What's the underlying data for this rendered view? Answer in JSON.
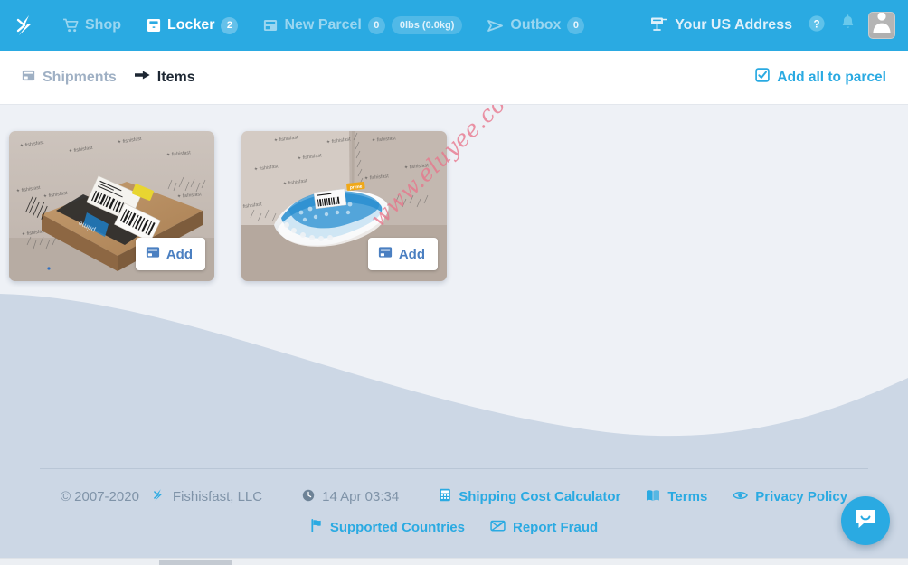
{
  "colors": {
    "brand_blue": "#2aaae2",
    "nav_inactive": "#9ad6f0",
    "wave_dark": "#ccd7e5",
    "wave_light": "#eaeef4",
    "page_bg": "#eef1f6",
    "watermark": "#e8768c",
    "add_text": "#4a7fc1"
  },
  "header": {
    "brand_icon": "fishisfast-logo-icon",
    "nav": [
      {
        "label": "Shop",
        "icon": "shopping-cart-icon",
        "active": false,
        "badge": null,
        "pill": null
      },
      {
        "label": "Locker",
        "icon": "locker-box-icon",
        "active": true,
        "badge": "2",
        "pill": null
      },
      {
        "label": "New Parcel",
        "icon": "parcel-box-icon",
        "active": false,
        "badge": "0",
        "pill": "0lbs (0.0kg)"
      },
      {
        "label": "Outbox",
        "icon": "paper-plane-icon",
        "active": false,
        "badge": "0",
        "pill": null
      }
    ],
    "address_label": "Your US Address",
    "address_icon": "mailbox-icon",
    "help_icon": "question-circle-icon",
    "bell_icon": "notification-bell-icon",
    "avatar_icon": "user-avatar-icon"
  },
  "subnav": {
    "tabs": [
      {
        "label": "Shipments",
        "icon": "shipments-box-icon",
        "active": false
      },
      {
        "label": "Items",
        "icon": "arrow-right-icon",
        "active": true
      }
    ],
    "action": {
      "label": "Add all to parcel",
      "icon": "checkbox-checked-icon"
    }
  },
  "items": [
    {
      "photo_alt": "cardboard-amazon-prime-box-on-shelf",
      "add_label": "Add",
      "add_icon": "parcel-box-icon"
    },
    {
      "photo_alt": "blue-white-bubble-mailer-envelope",
      "add_label": "Add",
      "add_icon": "parcel-box-icon"
    }
  ],
  "watermark": {
    "text": "www.eluyee.com"
  },
  "footer": {
    "row1": [
      {
        "label": "© 2007-2020",
        "icon": null,
        "kind": "plain"
      },
      {
        "label": "Fishisfast, LLC",
        "icon": "fishisfast-logo-icon",
        "kind": "plain"
      },
      {
        "label": "14 Apr 03:34",
        "icon": "clock-icon",
        "kind": "time"
      },
      {
        "label": "Shipping Cost Calculator",
        "icon": "calculator-icon",
        "kind": "lnk"
      },
      {
        "label": "Terms",
        "icon": "book-icon",
        "kind": "lnk"
      },
      {
        "label": "Privacy Policy",
        "icon": "eye-icon",
        "kind": "lnk"
      }
    ],
    "row2": [
      {
        "label": "Supported Countries",
        "icon": "flag-icon",
        "kind": "lnk"
      },
      {
        "label": "Report Fraud",
        "icon": "envelope-warning-icon",
        "kind": "lnk"
      }
    ]
  },
  "intercom": {
    "icon": "chat-smile-bubble-icon",
    "label": "Open chat"
  }
}
